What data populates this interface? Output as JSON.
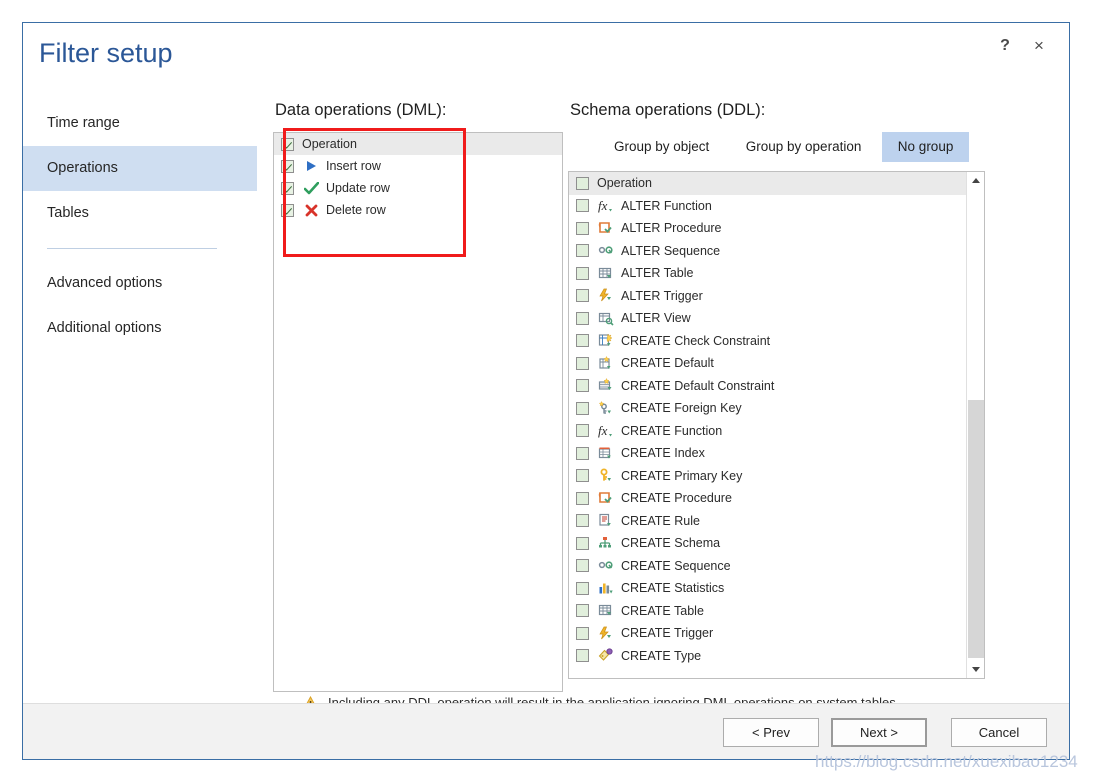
{
  "dialog": {
    "title": "Filter setup",
    "help_button": "?",
    "close_button": "×"
  },
  "sidebar": {
    "items": [
      {
        "label": "Time range",
        "selected": false
      },
      {
        "label": "Operations",
        "selected": true
      },
      {
        "label": "Tables",
        "selected": false
      },
      {
        "label": "Advanced options",
        "selected": false
      },
      {
        "label": "Additional options",
        "selected": false
      }
    ]
  },
  "dml_panel": {
    "heading": "Data operations (DML):",
    "header_row": {
      "label": "Operation",
      "checked": true
    },
    "rows": [
      {
        "label": "Insert row",
        "checked": true,
        "icon": "insert-row-icon"
      },
      {
        "label": "Update row",
        "checked": true,
        "icon": "update-row-icon"
      },
      {
        "label": "Delete row",
        "checked": true,
        "icon": "delete-row-icon"
      }
    ]
  },
  "ddl_panel": {
    "heading": "Schema operations (DDL):",
    "tabs": [
      {
        "label": "Group by object",
        "active": false
      },
      {
        "label": "Group by operation",
        "active": false
      },
      {
        "label": "No group",
        "active": true
      }
    ],
    "header_row": {
      "label": "Operation",
      "checked": false
    },
    "rows": [
      {
        "label": "ALTER Function",
        "checked": false,
        "icon": "function-icon"
      },
      {
        "label": "ALTER Procedure",
        "checked": false,
        "icon": "procedure-icon"
      },
      {
        "label": "ALTER Sequence",
        "checked": false,
        "icon": "sequence-icon"
      },
      {
        "label": "ALTER Table",
        "checked": false,
        "icon": "table-icon"
      },
      {
        "label": "ALTER Trigger",
        "checked": false,
        "icon": "trigger-icon"
      },
      {
        "label": "ALTER View",
        "checked": false,
        "icon": "view-icon"
      },
      {
        "label": "CREATE Check Constraint",
        "checked": false,
        "icon": "check-constraint-icon"
      },
      {
        "label": "CREATE Default",
        "checked": false,
        "icon": "default-icon"
      },
      {
        "label": "CREATE Default Constraint",
        "checked": false,
        "icon": "default-constraint-icon"
      },
      {
        "label": "CREATE Foreign Key",
        "checked": false,
        "icon": "foreign-key-icon"
      },
      {
        "label": "CREATE Function",
        "checked": false,
        "icon": "function-icon"
      },
      {
        "label": "CREATE Index",
        "checked": false,
        "icon": "index-icon"
      },
      {
        "label": "CREATE Primary Key",
        "checked": false,
        "icon": "primary-key-icon"
      },
      {
        "label": "CREATE Procedure",
        "checked": false,
        "icon": "procedure-icon"
      },
      {
        "label": "CREATE Rule",
        "checked": false,
        "icon": "rule-icon"
      },
      {
        "label": "CREATE Schema",
        "checked": false,
        "icon": "schema-icon"
      },
      {
        "label": "CREATE Sequence",
        "checked": false,
        "icon": "sequence-icon"
      },
      {
        "label": "CREATE Statistics",
        "checked": false,
        "icon": "statistics-icon"
      },
      {
        "label": "CREATE Table",
        "checked": false,
        "icon": "table-icon"
      },
      {
        "label": "CREATE Trigger",
        "checked": false,
        "icon": "trigger-icon"
      },
      {
        "label": "CREATE Type",
        "checked": false,
        "icon": "type-icon"
      }
    ]
  },
  "warning": {
    "text": "Including any DDL operation will result in the application ignoring DML operations on system tables",
    "icon": "warning-triangle-icon"
  },
  "footer": {
    "prev_label": "< Prev",
    "next_label": "Next >",
    "cancel_label": "Cancel"
  },
  "watermark": {
    "text": "https://blog.csdn.net/xuexibao1234"
  },
  "colors": {
    "title_blue": "#2b5797",
    "sidebar_selected": "#cfdef1",
    "tab_active": "#bdd2ee",
    "annotation_red": "#f01b1b",
    "insert_icon": "#2f6fc4",
    "update_icon": "#2f9e5e",
    "delete_icon": "#d8332a",
    "warning_amber": "#f0b429"
  }
}
